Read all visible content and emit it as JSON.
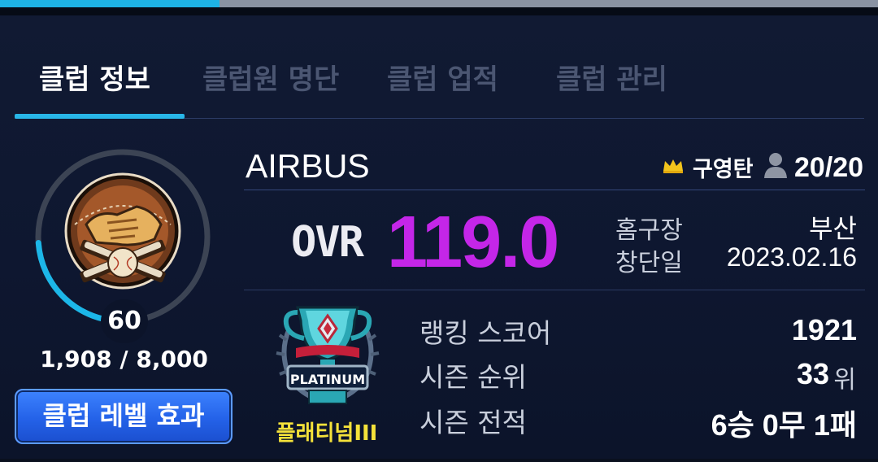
{
  "progress": {
    "fraction": 0.25,
    "fill_color": "#1eb3e6"
  },
  "tabs": [
    {
      "label": "클럽 정보",
      "active": true
    },
    {
      "label": "클럽원 명단",
      "active": false
    },
    {
      "label": "클럽 업적",
      "active": false
    },
    {
      "label": "클럽 관리",
      "active": false
    }
  ],
  "level": {
    "value": "60",
    "xp_text": "1,908 / 8,000",
    "xp_current": 1908,
    "xp_max": 8000,
    "ring_color": "#1cb7e8",
    "button_label": "클럽 레벨 효과"
  },
  "club": {
    "name": "AIRBUS",
    "owner": "구영탄",
    "member_count": "20/20"
  },
  "ovr": {
    "label": "OVR",
    "value": "119.0",
    "color": "#c426e8"
  },
  "info": {
    "home_label": "홈구장",
    "home_value": "부산",
    "founded_label": "창단일",
    "founded_value": "2023.02.16"
  },
  "tier": {
    "emblem_text": "PLATINUM",
    "name": "플래티넘III",
    "name_color": "#f5e23a"
  },
  "stats": {
    "ranking_label": "랭킹 스코어",
    "ranking_value": "1921",
    "season_rank_label": "시즌 순위",
    "season_rank_value": "33",
    "season_rank_unit": "위",
    "record_label": "시즌 전적",
    "record_value": "6승 0무 1패"
  },
  "icons": [
    "crown-icon",
    "member-icon",
    "club-emblem-icon",
    "tier-emblem-icon"
  ]
}
